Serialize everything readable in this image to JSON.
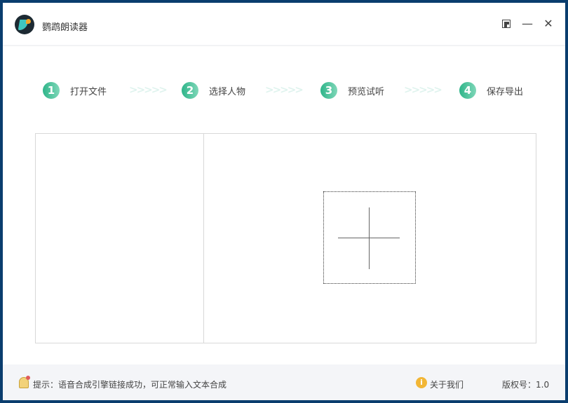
{
  "app": {
    "title": "鹦鹉朗读器"
  },
  "steps": [
    {
      "num": "1",
      "label": "打开文件"
    },
    {
      "num": "2",
      "label": "选择人物"
    },
    {
      "num": "3",
      "label": "预览试听"
    },
    {
      "num": "4",
      "label": "保存导出"
    }
  ],
  "arrows": ">>>>>",
  "window": {
    "min": "—",
    "close": "✕"
  },
  "status": {
    "tip": "提示：语音合成引擎链接成功，可正常输入文本合成",
    "about": "关于我们",
    "info_glyph": "i",
    "version": "版权号：1.0"
  },
  "colors": {
    "accent": "#2fb58a"
  }
}
